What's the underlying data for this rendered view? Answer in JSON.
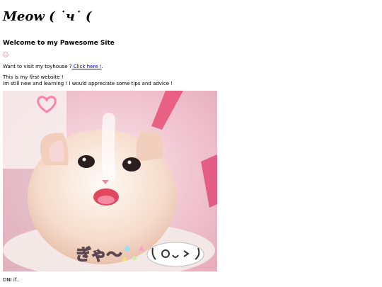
{
  "header": {
    "logo_text": "Meow ( ˙ч˙ ("
  },
  "main": {
    "welcome_heading": "Welcome to my Pawesome Site",
    "toyhouse": {
      "prefix": "Want to visit my toyhouse ?",
      "link_label": " Click here !",
      "suffix": "."
    },
    "intro": {
      "line1_prefix": "This is my ",
      "line1_emphasis": "first",
      "line1_suffix": " website !",
      "line2": "Im still new and learning ! I would appreciate some tips and advice !"
    },
    "image_caption": {
      "text": "ぎゃ〜"
    },
    "dni_text": "DNI if.."
  },
  "colors": {
    "link": "#0000ee",
    "image_background": "#f3cfd8"
  }
}
